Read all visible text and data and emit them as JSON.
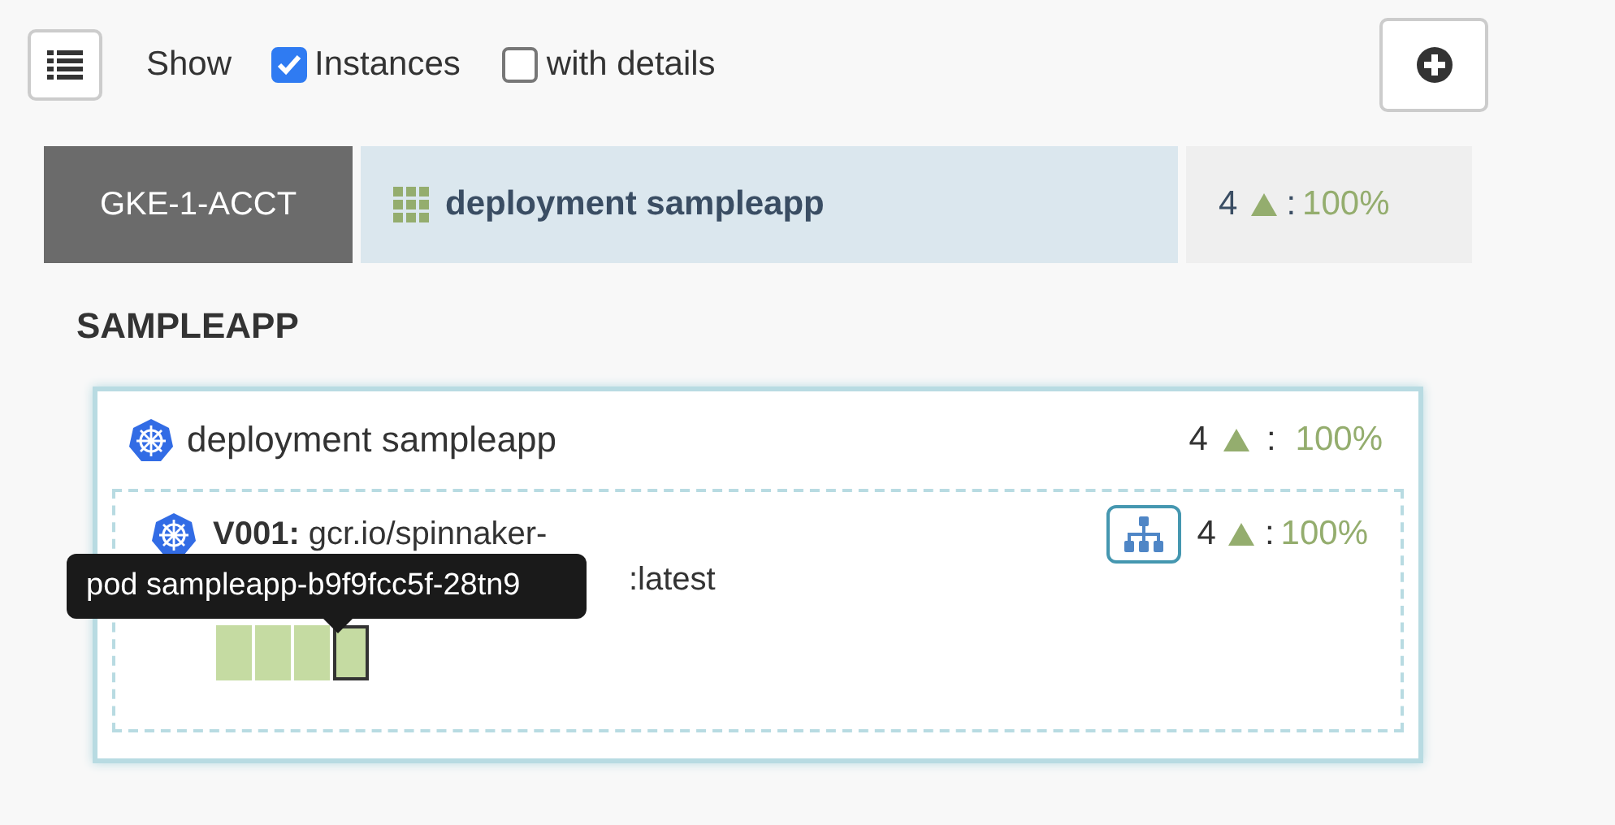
{
  "toolbar": {
    "show_label": "Show",
    "options": [
      {
        "label": "Instances",
        "checked": true
      },
      {
        "label": "with details",
        "checked": false
      }
    ]
  },
  "header": {
    "account": "GKE-1-ACCT",
    "cluster": "deployment sampleapp",
    "health": {
      "count": "4",
      "separator": ":",
      "percent": "100%"
    }
  },
  "application": {
    "title": "SAMPLEAPP",
    "cluster": {
      "name": "deployment sampleapp",
      "health": {
        "count": "4",
        "separator": ":",
        "percent": "100%"
      },
      "server_group": {
        "version": "V001:",
        "name_line1": "gcr.io/spinnaker-",
        "name_line2": ":latest",
        "health": {
          "count": "4",
          "separator": ":",
          "percent": "100%"
        },
        "instances": [
          {
            "color": "#c5dba2",
            "hovered": false
          },
          {
            "color": "#c5dba2",
            "hovered": false
          },
          {
            "color": "#c5dba2",
            "hovered": false
          },
          {
            "color": "#c5dba2",
            "hovered": true
          }
        ],
        "tooltip": "pod sampleapp-b9f9fcc5f-28tn9"
      }
    }
  }
}
